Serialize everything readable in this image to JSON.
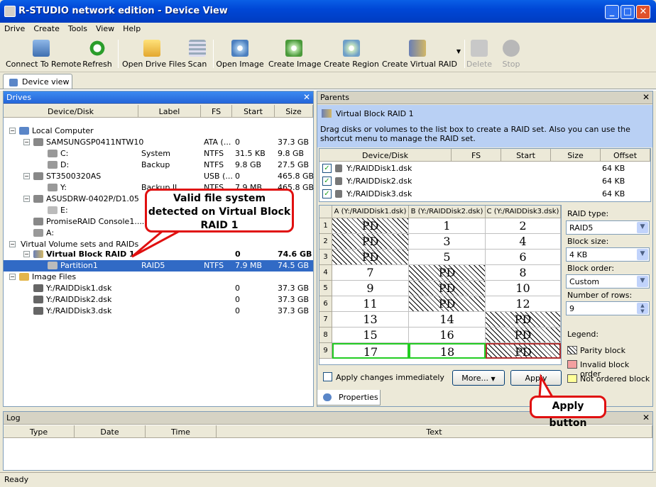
{
  "window": {
    "title": "R-STUDIO network edition - Device View"
  },
  "menu": [
    "Drive",
    "Create",
    "Tools",
    "View",
    "Help"
  ],
  "toolbar": {
    "connect": "Connect To Remote",
    "refresh": "Refresh",
    "open_drive_files": "Open Drive Files",
    "scan": "Scan",
    "open_image": "Open Image",
    "create_image": "Create Image",
    "create_region": "Create Region",
    "create_virtual_raid": "Create Virtual RAID",
    "delete": "Delete",
    "stop": "Stop"
  },
  "doc_tab": "Device view",
  "drives": {
    "title": "Drives",
    "columns": [
      "Device/Disk",
      "Label",
      "FS",
      "Start",
      "Size"
    ],
    "rows": [
      {
        "name": "Local Computer",
        "label": "",
        "fs": "",
        "start": "",
        "size": ""
      },
      {
        "name": "SAMSUNGSP0411NTW10",
        "label": "",
        "fs": "ATA (...",
        "start": "0",
        "size": "37.3 GB"
      },
      {
        "name": "C:",
        "label": "System",
        "fs": "NTFS",
        "start": "31.5 KB",
        "size": "9.8 GB"
      },
      {
        "name": "D:",
        "label": "Backup",
        "fs": "NTFS",
        "start": "9.8 GB",
        "size": "27.5 GB"
      },
      {
        "name": "ST3500320AS",
        "label": "",
        "fs": "USB (...",
        "start": "0",
        "size": "465.8 GB"
      },
      {
        "name": "Y:",
        "label": "Backup II",
        "fs": "NTFS",
        "start": "7.9 MB",
        "size": "465.8 GB"
      },
      {
        "name": "ASUSDRW-0402P/D1.05",
        "label": "",
        "fs": "",
        "start": "",
        "size": ""
      },
      {
        "name": "E:",
        "label": "",
        "fs": "",
        "start": "",
        "size": ""
      },
      {
        "name": "PromiseRAID Console1....",
        "label": "",
        "fs": "",
        "start": "",
        "size": ""
      },
      {
        "name": "A:",
        "label": "",
        "fs": "",
        "start": "",
        "size": ""
      },
      {
        "name": "Virtual Volume sets and RAIDs",
        "label": "",
        "fs": "",
        "start": "",
        "size": ""
      },
      {
        "name": "Virtual Block RAID 1",
        "label": "",
        "fs": "",
        "start": "0",
        "size": "74.6 GB"
      },
      {
        "name": "Partition1",
        "label": "RAID5",
        "fs": "NTFS",
        "start": "7.9 MB",
        "size": "74.5 GB"
      },
      {
        "name": "Image Files",
        "label": "",
        "fs": "",
        "start": "",
        "size": ""
      },
      {
        "name": "Y:/RAIDDisk1.dsk",
        "label": "",
        "fs": "",
        "start": "0",
        "size": "37.3 GB"
      },
      {
        "name": "Y:/RAIDDisk2.dsk",
        "label": "",
        "fs": "",
        "start": "0",
        "size": "37.3 GB"
      },
      {
        "name": "Y:/RAIDDisk3.dsk",
        "label": "",
        "fs": "",
        "start": "0",
        "size": "37.3 GB"
      }
    ]
  },
  "parents": {
    "title": "Parents",
    "heading": "Virtual Block RAID 1",
    "hint": "Drag disks or volumes to the list box to create a RAID set. Also you can use the shortcut menu to manage the RAID set.",
    "columns": [
      "Device/Disk",
      "FS",
      "Start",
      "Size",
      "Offset"
    ],
    "disks": [
      {
        "name": "Y:/RAIDDisk1.dsk",
        "offset": "64 KB"
      },
      {
        "name": "Y:/RAIDDisk2.dsk",
        "offset": "64 KB"
      },
      {
        "name": "Y:/RAIDDisk3.dsk",
        "offset": "64 KB"
      }
    ],
    "grid": {
      "columns": [
        "A (Y:/RAIDDisk1.dsk)",
        "B (Y:/RAIDDisk2.dsk)",
        "C (Y:/RAIDDisk3.dsk)"
      ],
      "rows": [
        [
          "PD",
          "1",
          "2"
        ],
        [
          "PD",
          "3",
          "4"
        ],
        [
          "PD",
          "5",
          "6"
        ],
        [
          "7",
          "PD",
          "8"
        ],
        [
          "9",
          "PD",
          "10"
        ],
        [
          "11",
          "PD",
          "12"
        ],
        [
          "13",
          "14",
          "PD"
        ],
        [
          "15",
          "16",
          "PD"
        ],
        [
          "17",
          "18",
          "PD"
        ]
      ],
      "row_numbers": [
        "1",
        "2",
        "3",
        "4",
        "5",
        "6",
        "7",
        "8",
        "9"
      ]
    },
    "raid_type_label": "RAID type:",
    "raid_type": "RAID5",
    "block_size_label": "Block size:",
    "block_size": "4 KB",
    "block_order_label": "Block order:",
    "block_order": "Custom",
    "rows_label": "Number of rows:",
    "rows": "9",
    "legend_label": "Legend:",
    "legend": [
      "Parity block",
      "Invalid block order",
      "Not ordered block"
    ],
    "apply_immediately": "Apply changes immediately",
    "more_button": "More...",
    "apply_button": "Apply"
  },
  "properties_tab": "Properties",
  "log": {
    "title": "Log",
    "columns": [
      "Type",
      "Date",
      "Time",
      "Text"
    ]
  },
  "status": "Ready",
  "callouts": {
    "valid_fs": "Valid file system detected on Virtual Block RAID 1",
    "apply": "Apply button"
  },
  "colors": {
    "selection": "#316ac5",
    "callout_border": "#e01010",
    "invalid": "#f4a0a0",
    "not_ordered": "#ffff99"
  }
}
